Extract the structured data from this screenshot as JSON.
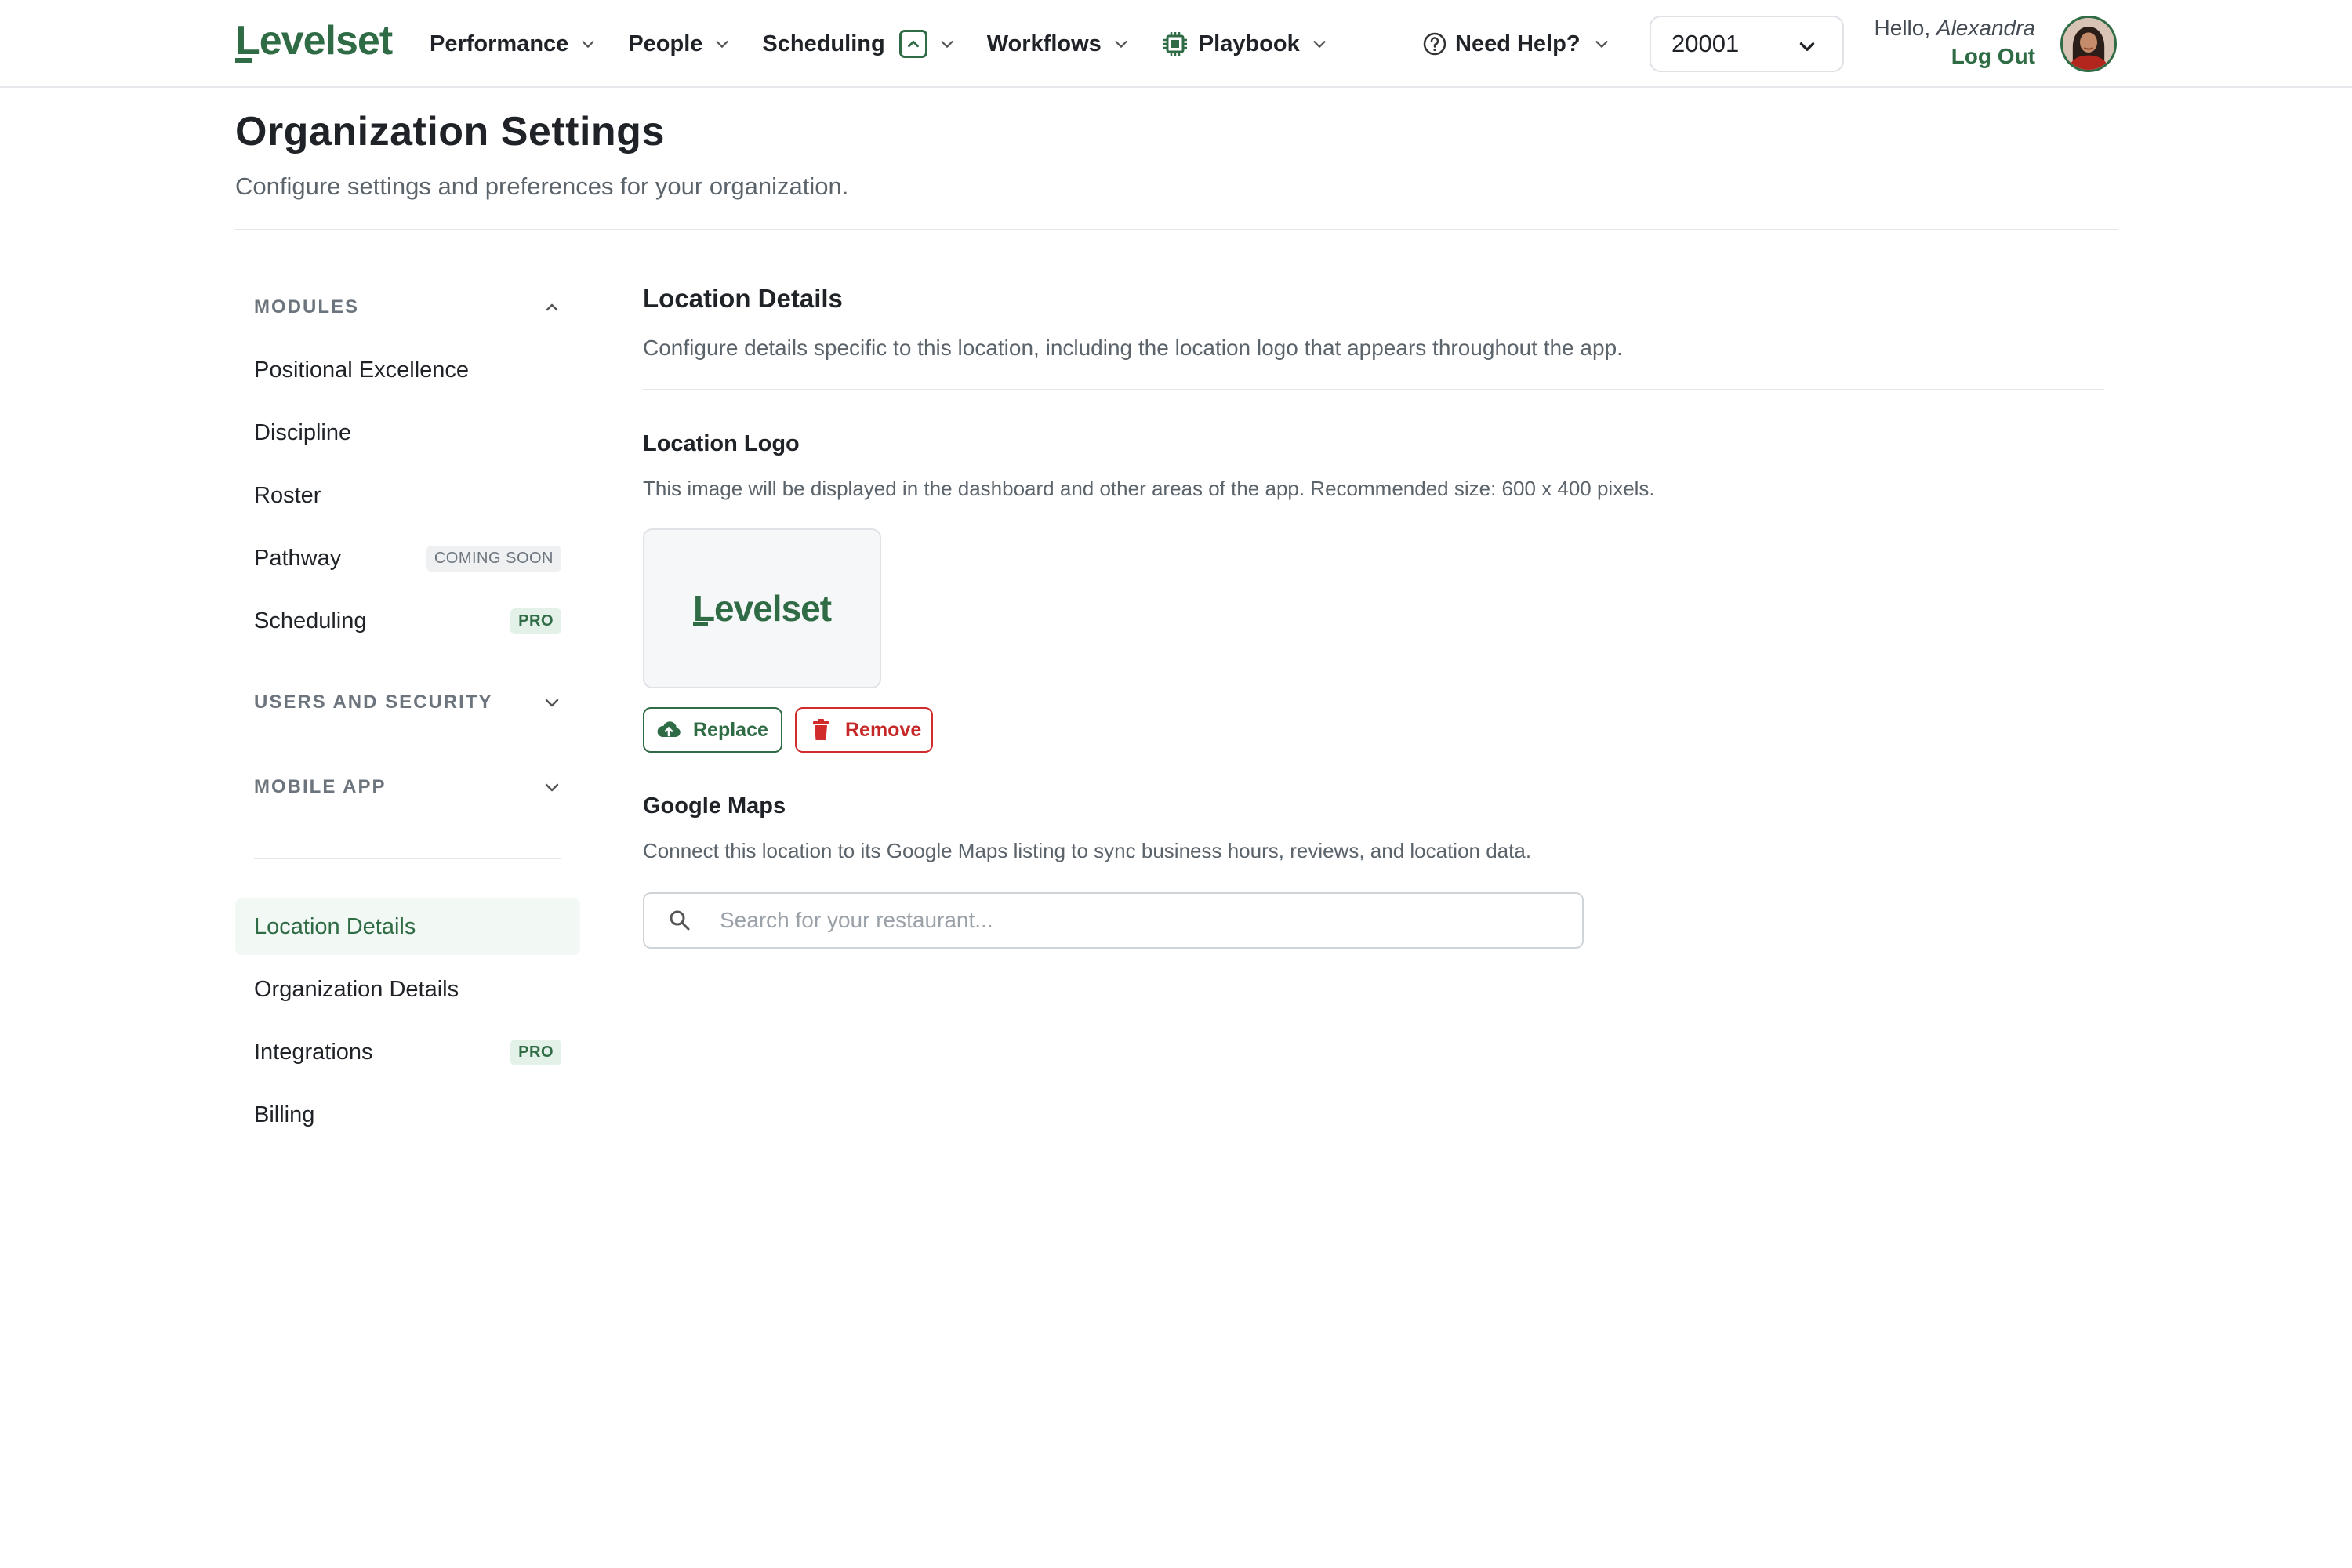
{
  "brand": {
    "logo_first": "L",
    "logo_rest": "evelset",
    "color": "#2f6b45"
  },
  "nav": {
    "performance": "Performance",
    "people": "People",
    "scheduling": "Scheduling",
    "workflows": "Workflows",
    "playbook": "Playbook",
    "help": "Need Help?",
    "location_value": "20001"
  },
  "user": {
    "hello": "Hello,",
    "name": "Alexandra",
    "logout": "Log Out"
  },
  "page": {
    "title": "Organization Settings",
    "subtitle": "Configure settings and preferences for your organization."
  },
  "sidebar": {
    "modules": {
      "label": "MODULES",
      "items": [
        {
          "label": "Positional Excellence"
        },
        {
          "label": "Discipline"
        },
        {
          "label": "Roster"
        },
        {
          "label": "Pathway",
          "badge": "COMING SOON"
        },
        {
          "label": "Scheduling",
          "badge": "PRO"
        }
      ]
    },
    "users_security": {
      "label": "USERS AND SECURITY"
    },
    "mobile_app": {
      "label": "MOBILE APP"
    },
    "settings_items": [
      {
        "label": "Location Details",
        "active": true
      },
      {
        "label": "Organization Details"
      },
      {
        "label": "Integrations",
        "badge": "PRO"
      },
      {
        "label": "Billing"
      }
    ]
  },
  "main": {
    "title": "Location Details",
    "description": "Configure details specific to this location, including the location logo that appears throughout the app.",
    "logo_section": {
      "title": "Location Logo",
      "description": "This image will be displayed in the dashboard and other areas of the app. Recommended size: 600 x 400 pixels.",
      "preview_first": "L",
      "preview_rest": "evelset",
      "replace_label": "Replace",
      "remove_label": "Remove"
    },
    "maps_section": {
      "title": "Google Maps",
      "description": "Connect this location to its Google Maps listing to sync business hours, reviews, and location data.",
      "search_placeholder": "Search for your restaurant...",
      "search_value": ""
    }
  },
  "colors": {
    "accent": "#2f6b45",
    "danger": "#d22b2b",
    "active_bg": "#f2f8f4",
    "text": "#1f2328",
    "muted": "#5b636b"
  }
}
